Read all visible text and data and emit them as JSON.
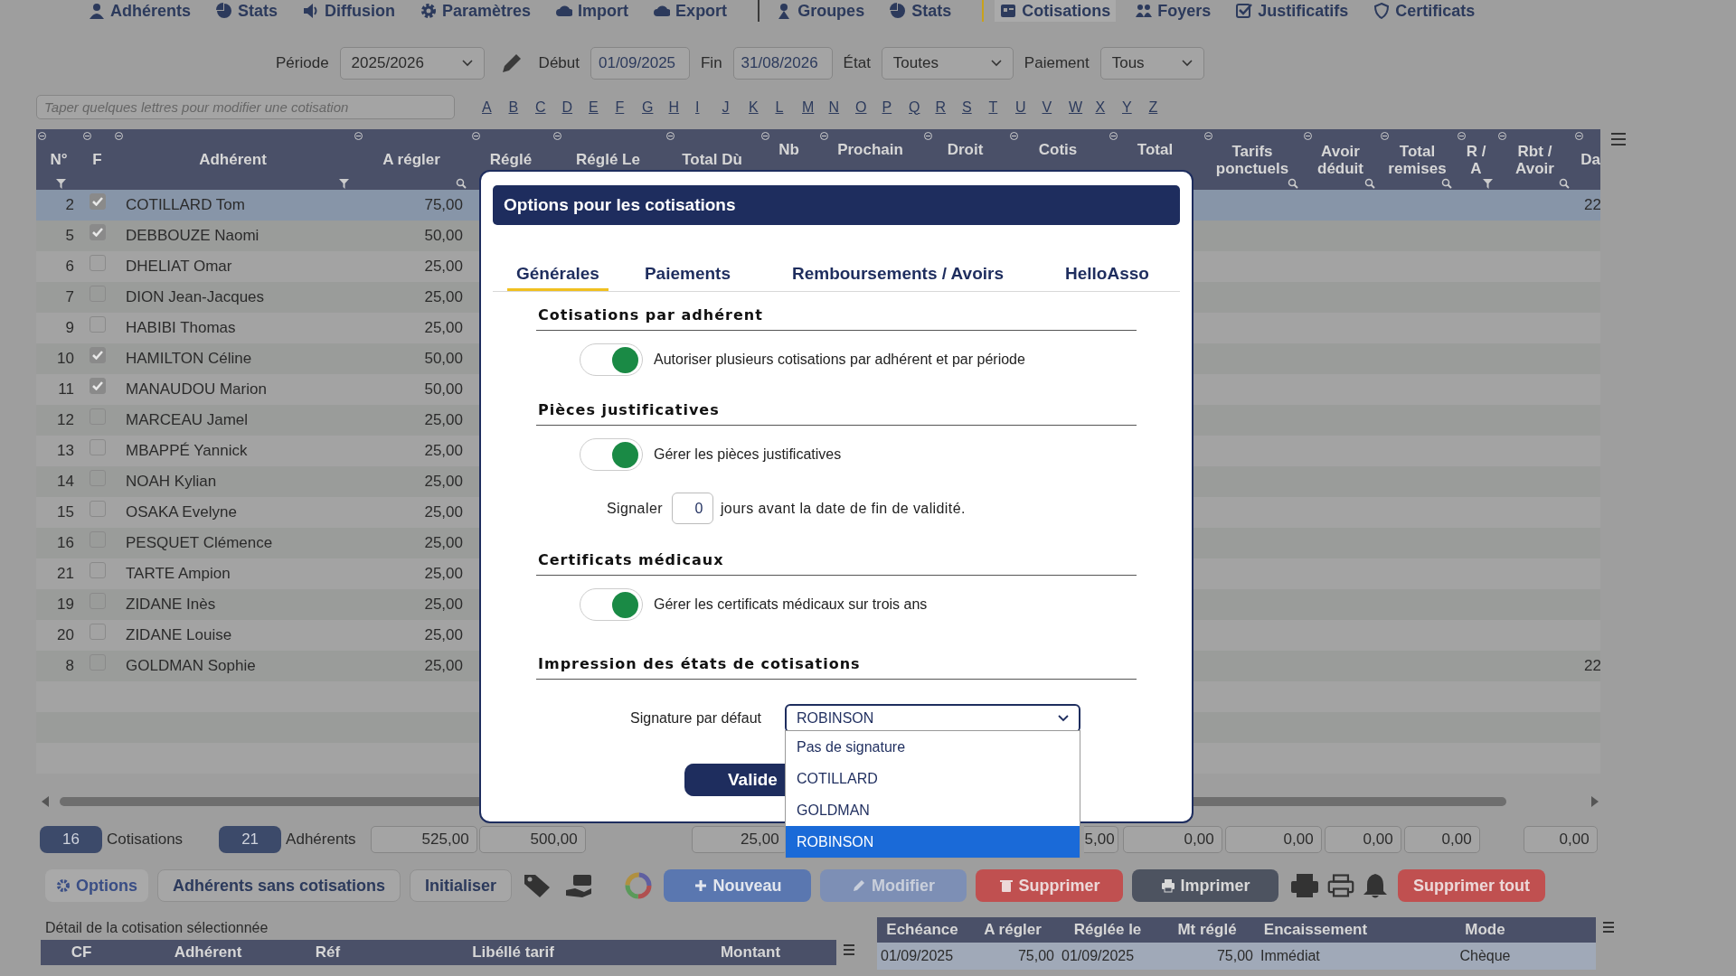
{
  "nav_groups": [
    [
      {
        "label": "Adhérents",
        "selected": false
      },
      {
        "label": "Stats",
        "selected": false
      },
      {
        "label": "Diffusion",
        "selected": false
      },
      {
        "label": "Paramètres",
        "selected": false
      },
      {
        "label": "Import",
        "selected": false
      },
      {
        "label": "Export",
        "selected": false
      }
    ],
    [
      {
        "label": "Groupes",
        "selected": false
      },
      {
        "label": "Stats",
        "selected": false
      }
    ],
    [
      {
        "label": "Cotisations",
        "selected": true
      },
      {
        "label": "Foyers",
        "selected": false
      },
      {
        "label": "Justificatifs",
        "selected": false
      },
      {
        "label": "Certificats",
        "selected": false
      }
    ]
  ],
  "filters": [
    {
      "kind": "select",
      "label": "Période",
      "value": "2025/2026"
    },
    {
      "kind": "date",
      "label": "Début",
      "value": "01/09/2025"
    },
    {
      "kind": "date",
      "label": "Fin",
      "value": "31/08/2026"
    },
    {
      "kind": "select",
      "label": "État",
      "value": "Toutes"
    },
    {
      "kind": "select",
      "label": "Paiement",
      "value": "Tous"
    }
  ],
  "search": {
    "placeholder": "Taper quelques lettres pour modifier une cotisation"
  },
  "letters": [
    "A",
    "B",
    "C",
    "D",
    "E",
    "F",
    "G",
    "H",
    "I",
    "J",
    "K",
    "L",
    "M",
    "N",
    "O",
    "P",
    "Q",
    "R",
    "S",
    "T",
    "U",
    "V",
    "W",
    "X",
    "Y",
    "Z"
  ],
  "table": {
    "columns": [
      "N°",
      "F",
      "Adhérent",
      "A régler",
      "Réglé",
      "Réglé Le",
      "Total Dù",
      "Nb",
      "Prochain",
      "Droit",
      "Cotis",
      "Total",
      "Tarifs\nponctuels",
      "Avoir\ndéduit",
      "Total\nremises",
      "R /\nA",
      "Rbt /\nAvoir",
      "Da"
    ],
    "rows": [
      {
        "num": "2",
        "checked": true,
        "name": "COTILLARD Tom",
        "amount": "75,00",
        "column_18": "22",
        "selected": true
      },
      {
        "num": "5",
        "checked": true,
        "name": "DEBBOUZE Naomi",
        "amount": "50,00",
        "selected": false
      },
      {
        "num": "6",
        "checked": false,
        "name": "DHELIAT Omar",
        "amount": "25,00",
        "selected": false
      },
      {
        "num": "7",
        "checked": false,
        "name": "DION Jean-Jacques",
        "amount": "25,00",
        "selected": false
      },
      {
        "num": "9",
        "checked": false,
        "name": "HABIBI Thomas",
        "amount": "25,00",
        "selected": false
      },
      {
        "num": "10",
        "checked": true,
        "name": "HAMILTON Céline",
        "amount": "50,00",
        "selected": false
      },
      {
        "num": "11",
        "checked": true,
        "name": "MANAUDOU Marion",
        "amount": "50,00",
        "selected": false
      },
      {
        "num": "12",
        "checked": false,
        "name": "MARCEAU Jamel",
        "amount": "25,00",
        "selected": false
      },
      {
        "num": "13",
        "checked": false,
        "name": "MBAPPÉ Yannick",
        "amount": "25,00",
        "selected": false
      },
      {
        "num": "14",
        "checked": false,
        "name": "NOAH Kylian",
        "amount": "25,00",
        "selected": false
      },
      {
        "num": "15",
        "checked": false,
        "name": "OSAKA Evelyne",
        "amount": "25,00",
        "selected": false
      },
      {
        "num": "16",
        "checked": false,
        "name": "PESQUET Clémence",
        "amount": "25,00",
        "selected": false
      },
      {
        "num": "21",
        "checked": false,
        "name": "TARTE Ampion",
        "amount": "25,00",
        "selected": false
      },
      {
        "num": "19",
        "checked": false,
        "name": "ZIDANE Inès",
        "amount": "25,00",
        "selected": false
      },
      {
        "num": "20",
        "checked": false,
        "name": "ZIDANE Louise",
        "amount": "25,00",
        "selected": false
      },
      {
        "num": "8",
        "checked": false,
        "name": "GOLDMAN Sophie",
        "amount": "25,00",
        "column_18": "22",
        "selected": false
      }
    ]
  },
  "counts": [
    {
      "value": "16",
      "label": "Cotisations"
    },
    {
      "value": "21",
      "label": "Adhérents"
    }
  ],
  "totals": [
    "525,00",
    "500,00",
    "25,00",
    "5,00",
    "0,00",
    "0,00",
    "0,00",
    "0,00",
    "0,00"
  ],
  "toolbar": [
    {
      "kind": "options",
      "label": "Options"
    },
    {
      "kind": "plain",
      "label": "Adhérents sans cotisations"
    },
    {
      "kind": "plain",
      "label": "Initialiser"
    },
    {
      "kind": "primary",
      "label": "Nouveau"
    },
    {
      "kind": "secondary",
      "label": "Modifier"
    },
    {
      "kind": "danger",
      "label": "Supprimer"
    },
    {
      "kind": "dark",
      "label": "Imprimer"
    },
    {
      "kind": "danger",
      "label": "Supprimer tout"
    }
  ],
  "detail": {
    "label": "Détail de la cotisation sélectionnée",
    "left_columns": [
      "CF",
      "Adhérent",
      "Réf",
      "Libéllé tarif",
      "Montant"
    ],
    "right_columns": [
      "Echéance",
      "A régler",
      "Réglée le",
      "Mt réglé",
      "Encaissement",
      "Mode"
    ],
    "right_rows": [
      [
        "01/09/2025",
        "75,00",
        "01/09/2025",
        "75,00",
        "Immédiat",
        "Chèque"
      ]
    ]
  },
  "modal": {
    "title": "Options pour les cotisations",
    "tabs": [
      {
        "label": "Générales",
        "selected": true
      },
      {
        "label": "Paiements",
        "selected": false
      },
      {
        "label": "Remboursements / Avoirs",
        "selected": false
      },
      {
        "label": "HelloAsso",
        "selected": false
      }
    ],
    "sections": [
      {
        "heading": "Cotisations par adhérent",
        "items": [
          {
            "kind": "toggle",
            "label": "Autoriser plusieurs cotisations par adhérent et par période",
            "on": true
          }
        ]
      },
      {
        "heading": "Pièces justificatives",
        "items": [
          {
            "kind": "toggle",
            "label": "Gérer les pièces justificatives",
            "on": true
          },
          {
            "kind": "days",
            "label": "Signaler",
            "value": "0",
            "suffix": "jours avant la date de fin de validité."
          }
        ]
      },
      {
        "heading": "Certificats médicaux",
        "items": [
          {
            "kind": "toggle",
            "label": "Gérer les certificats médicaux sur trois ans",
            "on": true
          }
        ]
      },
      {
        "heading": "Impression des états de cotisations",
        "items": [
          {
            "kind": "select",
            "label": "Signature par défaut",
            "value": "ROBINSON",
            "expanded": true,
            "options": [
              {
                "label": "Pas de signature",
                "selected": false
              },
              {
                "label": "COTILLARD",
                "selected": false
              },
              {
                "label": "GOLDMAN",
                "selected": false
              },
              {
                "label": "ROBINSON",
                "selected": true
              }
            ]
          }
        ]
      }
    ],
    "button": "Valide"
  }
}
